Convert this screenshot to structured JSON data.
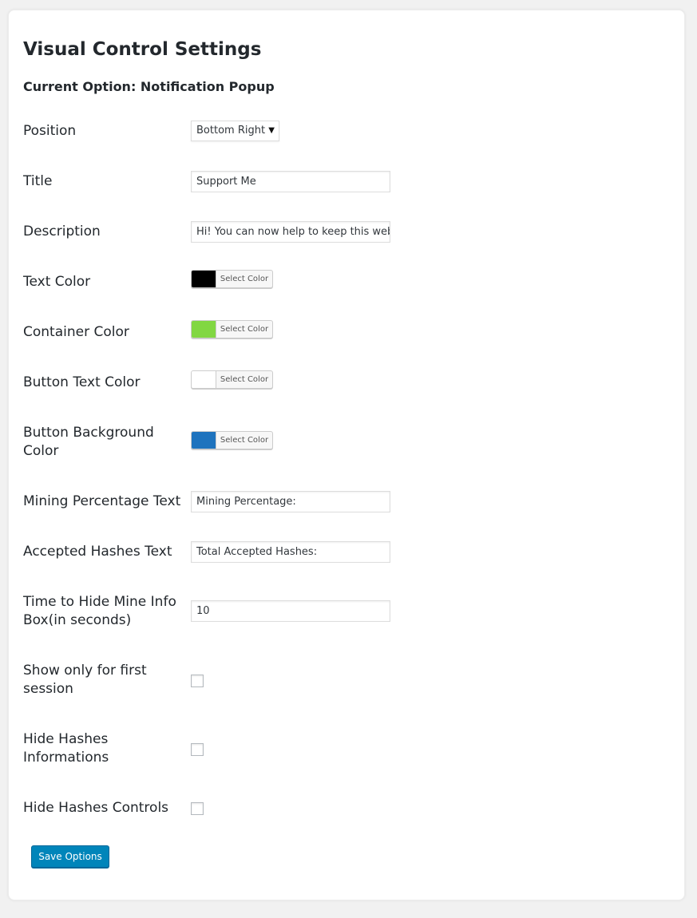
{
  "header": {
    "title": "Visual Control Settings",
    "current_option": "Current Option: Notification Popup"
  },
  "fields": {
    "position": {
      "label": "Position",
      "value": "Bottom Right"
    },
    "title": {
      "label": "Title",
      "value": "Support Me"
    },
    "description": {
      "label": "Description",
      "value": "Hi! You can now help to keep this website"
    },
    "text_color": {
      "label": "Text Color",
      "picker_label": "Select Color",
      "color": "#000000"
    },
    "container_color": {
      "label": "Container Color",
      "picker_label": "Select Color",
      "color": "#81d742"
    },
    "button_text_color": {
      "label": "Button Text Color",
      "picker_label": "Select Color",
      "color": "#ffffff"
    },
    "button_background_color": {
      "label": "Button Background Color",
      "picker_label": "Select Color",
      "color": "#1e73be"
    },
    "mining_percentage_text": {
      "label": "Mining Percentage Text",
      "value": "Mining Percentage:"
    },
    "accepted_hashes_text": {
      "label": "Accepted Hashes Text",
      "value": "Total Accepted Hashes:"
    },
    "time_to_hide": {
      "label": "Time to Hide Mine Info Box(in seconds)",
      "value": "10"
    },
    "show_first_session": {
      "label": "Show only for first session",
      "checked": false
    },
    "hide_hashes_info": {
      "label": "Hide Hashes Informations",
      "checked": false
    },
    "hide_hashes_controls": {
      "label": "Hide Hashes Controls",
      "checked": false
    }
  },
  "actions": {
    "save_label": "Save Options"
  },
  "colors": {
    "primary_button": "#0085ba"
  }
}
